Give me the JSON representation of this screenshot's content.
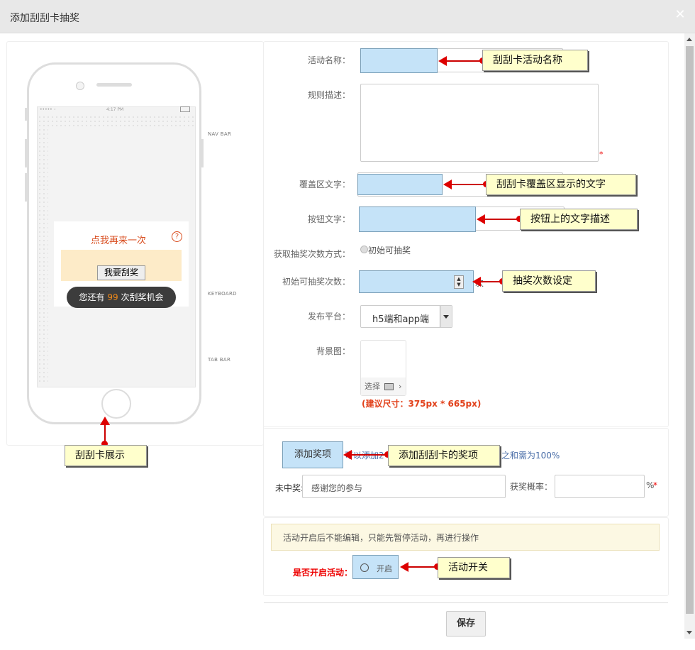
{
  "window": {
    "title": "添加刮刮卡抽奖",
    "close_icon": "close-icon"
  },
  "preview": {
    "status_time": "4:17 PM",
    "labels": {
      "nav_bar": "NAV BAR",
      "keyboard": "KEYBOARD",
      "tab_bar": "TAB BAR"
    },
    "card_title": "点我再来一次",
    "help_symbol": "?",
    "scratch_button": "我要刮奖",
    "chances_prefix": "您还有",
    "chances_count": "99",
    "chances_suffix": "次刮奖机会"
  },
  "form": {
    "activity_name_label": "活动名称：",
    "rules_label": "规则描述：",
    "rules_required": "*",
    "cover_text_label": "覆盖区文字：",
    "button_text_label": "按钮文字：",
    "draw_mode_label": "获取抽奖次数方式：",
    "draw_mode_option": "初始可抽奖",
    "initial_count_label": "初始可抽奖次数：",
    "initial_count_suffix": "次",
    "platform_label": "发布平台：",
    "platform_value": "h5端和app端",
    "background_label": "背景图：",
    "background_select": "选择",
    "size_hint": "(建议尺寸：375px * 665px)"
  },
  "prizes": {
    "add_button": "添加奖项",
    "hint_left": "可以添加2",
    "hint_right": "之和需为100%",
    "no_prize_label": "未中奖:",
    "no_prize_value": "感谢您的参与",
    "probability_label": "获奖概率：",
    "percent": "%",
    "required": "*"
  },
  "activity": {
    "notice": "活动开启后不能编辑，只能先暂停活动，再进行操作",
    "enable_label": "是否开启活动：",
    "toggle_label": "开启"
  },
  "footer": {
    "save": "保存"
  },
  "callouts": {
    "name": "刮刮卡活动名称",
    "cover": "刮刮卡覆盖区显示的文字",
    "button": "按钮上的文字描述",
    "count": "抽奖次数设定",
    "preview": "刮刮卡展示",
    "prize": "添加刮刮卡的奖项",
    "toggle": "活动开关"
  },
  "colors": {
    "accent_red": "#e2421c",
    "highlight_blue": "#c5e3f8",
    "callout_yellow": "#ffffcc"
  }
}
